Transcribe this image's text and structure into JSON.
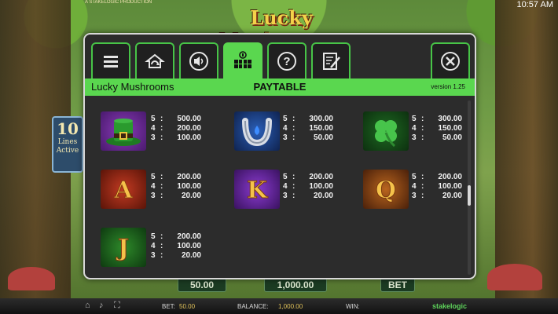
{
  "background": {
    "producer_text": "A STAKELOGIC PRODUCTION",
    "logo_text": "Lucky Mushrooms",
    "clock": "10:57 AM",
    "lines_badge": {
      "number": "10",
      "line1": "Lines",
      "line2": "Active"
    }
  },
  "bottom_bar": {
    "bet_label": "BET:",
    "bet_value": "50.00",
    "balance_label": "BALANCE:",
    "balance_value": "1,000.00",
    "win_label": "WIN:",
    "brand": "stakelogic",
    "controls": {
      "stake": "50.00",
      "balance_box": "1,000.00",
      "bet_button": "BET"
    }
  },
  "dialog": {
    "tabs": [
      {
        "name": "tab-menu",
        "icon": "menu-icon",
        "active": false
      },
      {
        "name": "tab-autoplay",
        "icon": "autoplay-icon",
        "active": false
      },
      {
        "name": "tab-sound",
        "icon": "sound-icon",
        "active": false
      },
      {
        "name": "tab-paytable",
        "icon": "paytable-icon",
        "active": true
      },
      {
        "name": "tab-help",
        "icon": "help-icon",
        "active": false
      },
      {
        "name": "tab-history",
        "icon": "history-icon",
        "active": false
      }
    ],
    "close_icon": "close-icon",
    "game_name": "Lucky Mushrooms",
    "title": "PAYTABLE",
    "version": "version 1.25",
    "accent_color": "#5ad74f",
    "symbols": [
      {
        "id": "hat",
        "label": "",
        "pays": [
          [
            "5",
            "500.00"
          ],
          [
            "4",
            "200.00"
          ],
          [
            "3",
            "100.00"
          ]
        ]
      },
      {
        "id": "horseshoe",
        "label": "",
        "pays": [
          [
            "5",
            "300.00"
          ],
          [
            "4",
            "150.00"
          ],
          [
            "3",
            "50.00"
          ]
        ]
      },
      {
        "id": "clover",
        "label": "",
        "pays": [
          [
            "5",
            "300.00"
          ],
          [
            "4",
            "150.00"
          ],
          [
            "3",
            "50.00"
          ]
        ]
      },
      {
        "id": "a",
        "label": "A",
        "pays": [
          [
            "5",
            "200.00"
          ],
          [
            "4",
            "100.00"
          ],
          [
            "3",
            "20.00"
          ]
        ]
      },
      {
        "id": "k",
        "label": "K",
        "pays": [
          [
            "5",
            "200.00"
          ],
          [
            "4",
            "100.00"
          ],
          [
            "3",
            "20.00"
          ]
        ]
      },
      {
        "id": "q",
        "label": "Q",
        "pays": [
          [
            "5",
            "200.00"
          ],
          [
            "4",
            "100.00"
          ],
          [
            "3",
            "20.00"
          ]
        ]
      },
      {
        "id": "j",
        "label": "J",
        "pays": [
          [
            "5",
            "200.00"
          ],
          [
            "4",
            "100.00"
          ],
          [
            "3",
            "20.00"
          ]
        ]
      }
    ],
    "scroll_position": 0.55
  }
}
